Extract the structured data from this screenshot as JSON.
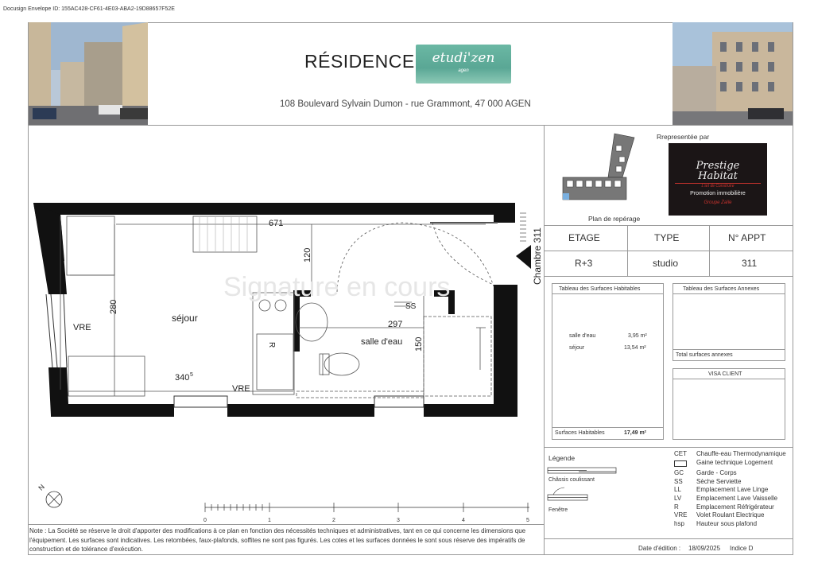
{
  "envelope_id": "Docusign Envelope ID: 155AC428-CF61-4E03-ABA2-19D88657F52E",
  "header": {
    "title": "RÉSIDENCE",
    "logo_text": "etudi'zen",
    "logo_sub": "agen",
    "address": "108 Boulevard Sylvain Dumon - rue Grammont, 47 000 AGEN"
  },
  "plan": {
    "watermark": "Signature en cours",
    "labels": {
      "sejour": "séjour",
      "salle_eau": "salle d'eau",
      "vre_left": "VRE",
      "vre_bottom": "VRE",
      "ss": "SS",
      "r": "R",
      "chambre": "Chambre 311"
    },
    "dims": {
      "d671": "671",
      "d120": "120",
      "d280": "280",
      "d297": "297",
      "d150": "150",
      "d340": "340",
      "d340_sup": "5"
    },
    "scale_ticks": [
      "0",
      "1",
      "2",
      "3",
      "4",
      "5"
    ],
    "north": "N"
  },
  "side": {
    "plan_reperage": "Plan de repérage",
    "representee_par": "Rrepresentée par",
    "prestige": {
      "line1": "Prestige",
      "line2": "Habitat",
      "line3": "L'art de Construire",
      "line4": "Promotion immobilière",
      "line5": "Groupe Zaïle"
    },
    "table_headers": [
      "ETAGE",
      "TYPE",
      "N° APPT"
    ],
    "table_values": [
      "R+3",
      "studio",
      "311"
    ]
  },
  "surfaces": {
    "title": "Tableau des Surfaces Habitables",
    "rows": [
      {
        "name": "salle d'eau",
        "value": "3,95 m²"
      },
      {
        "name": "séjour",
        "value": "13,54 m²"
      }
    ],
    "total_label": "Surfaces Habitables",
    "total_value": "17,49 m²"
  },
  "annexes": {
    "title": "Tableau des Surfaces Annexes",
    "total_label": "Total surfaces annexes"
  },
  "visa": {
    "title": "VISA CLIENT"
  },
  "legend": {
    "title": "Légende",
    "chassis": "Châssis coulissant",
    "fenetre": "Fenêtre",
    "codes": [
      {
        "code": "CET",
        "desc": "Chauffe-eau Thermodynamique"
      },
      {
        "code": "",
        "desc": "Gaine technique Logement"
      },
      {
        "code": "GC",
        "desc": "Garde - Corps"
      },
      {
        "code": "SS",
        "desc": "Sèche Serviette"
      },
      {
        "code": "LL",
        "desc": "Emplacement Lave Linge"
      },
      {
        "code": "LV",
        "desc": "Emplacement Lave Vaisselle"
      },
      {
        "code": "R",
        "desc": "Emplacement Réfrigérateur"
      },
      {
        "code": "VRE",
        "desc": "Volet Roulant Electrique"
      },
      {
        "code": "hsp",
        "desc": "Hauteur sous plafond"
      }
    ]
  },
  "footer": {
    "note": "Note : La Société se réserve le droit d'apporter des modifications à ce plan en fonction des nécessités techniques et administratives, tant en ce qui concerne les dimensions que l'équipement. Les surfaces sont indicatives. Les retombées, faux-plafonds, soffites ne sont pas figurés. Les cotes et les surfaces données le sont sous réserve des impératifs de construction et de tolérance d'exécution.",
    "date_label": "Date d'édition :",
    "date_value": "18/09/2025",
    "index": "Indice D"
  }
}
